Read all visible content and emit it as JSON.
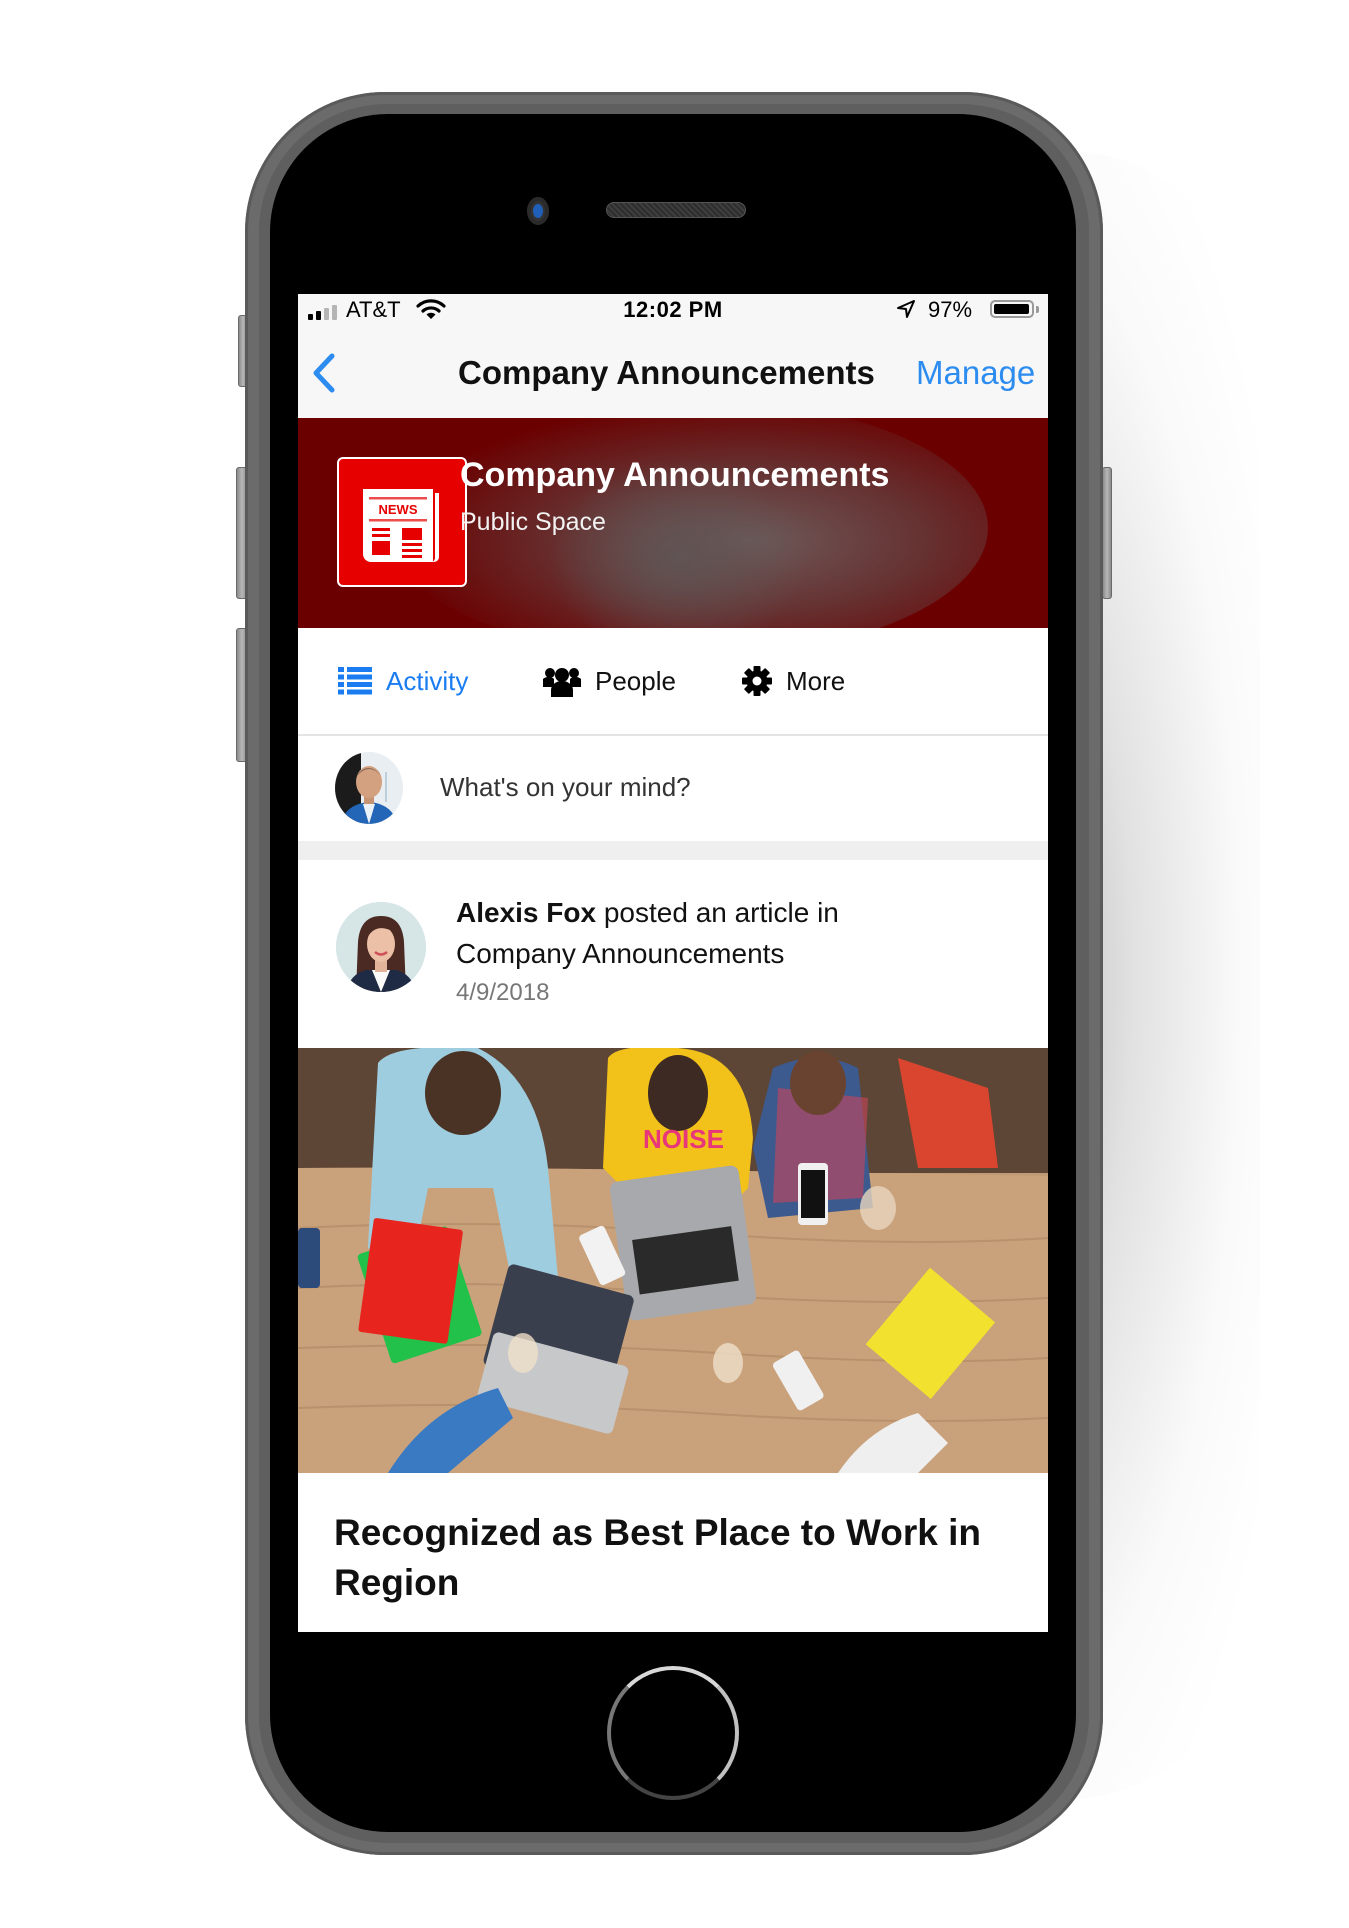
{
  "status_bar": {
    "carrier": "AT&T",
    "signal_bars_filled": 2,
    "signal_bars_total": 4,
    "time": "12:02 PM",
    "battery_percent_label": "97%",
    "battery_level": 0.97,
    "icons": [
      "signal-icon",
      "wifi-icon",
      "location-arrow-icon",
      "battery-icon"
    ]
  },
  "nav": {
    "back_icon": "chevron-left-icon",
    "title": "Company Announcements",
    "action_label": "Manage"
  },
  "space": {
    "icon": "newspaper-icon",
    "icon_text": "NEWS",
    "title": "Company Announcements",
    "subtitle": "Public Space",
    "banner_color": "#6b0000",
    "icon_bg_color": "#e60000"
  },
  "tabs": [
    {
      "label": "Activity",
      "icon": "list-icon",
      "active": true
    },
    {
      "label": "People",
      "icon": "people-icon",
      "active": false
    },
    {
      "label": "More",
      "icon": "gear-icon",
      "active": false
    }
  ],
  "compose": {
    "placeholder": "What's on your mind?"
  },
  "post": {
    "author": "Alexis Fox",
    "action": " posted an article in",
    "space": "Company Announcements",
    "date": "4/9/2018",
    "headline": "Recognized as Best Place to Work in Region"
  },
  "colors": {
    "accent": "#2d8cf0",
    "active_tab": "#1a7cf0",
    "separator": "#efeff0"
  }
}
